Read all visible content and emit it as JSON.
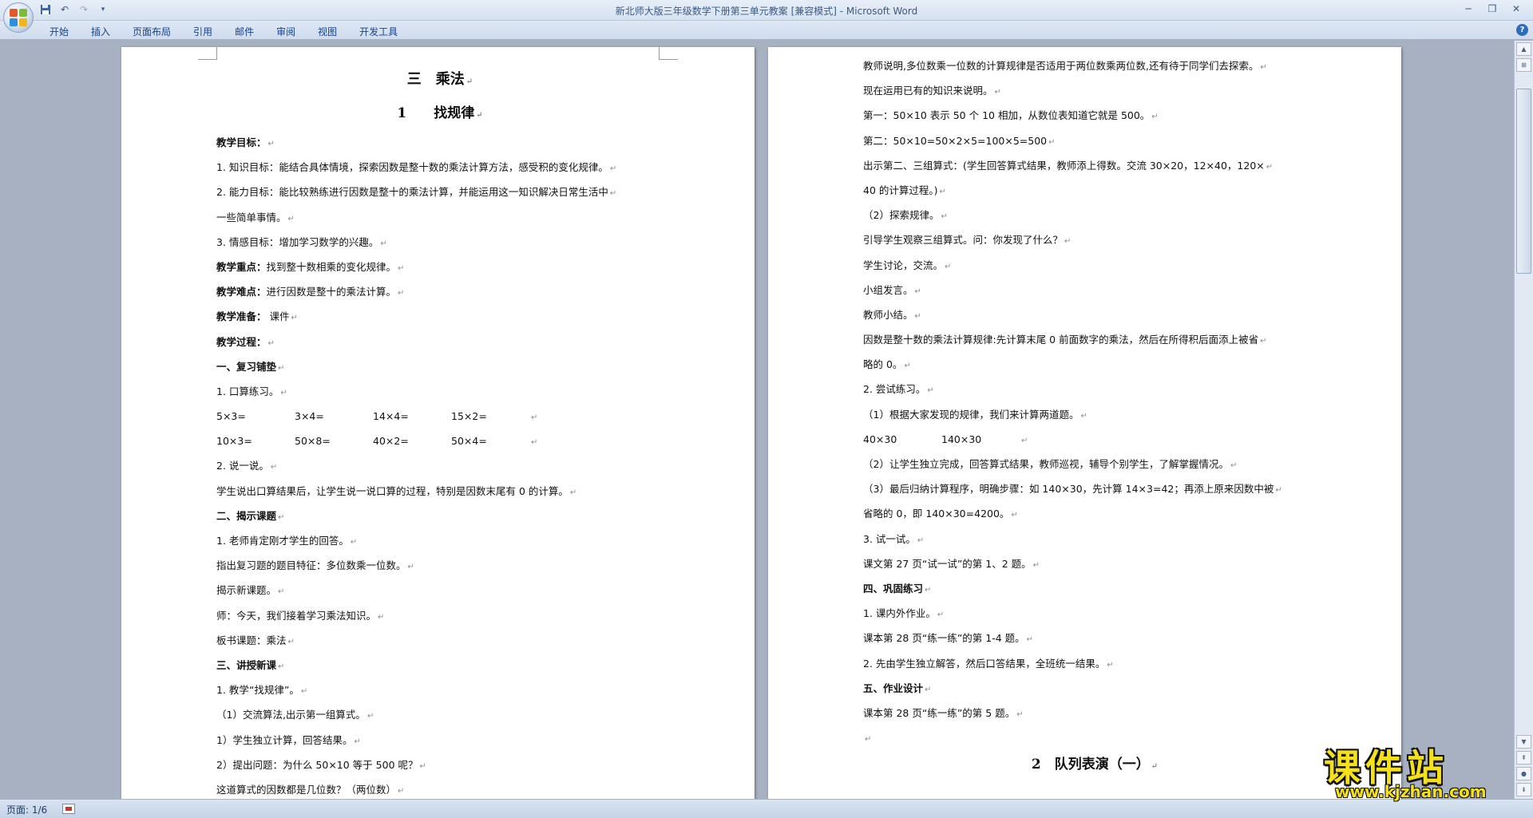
{
  "window": {
    "title": "新北师大版三年级数学下册第三单元教案 [兼容模式] - Microsoft Word"
  },
  "ribbon": {
    "tabs": [
      "开始",
      "插入",
      "页面布局",
      "引用",
      "邮件",
      "审阅",
      "视图",
      "开发工具"
    ]
  },
  "page1": {
    "heading": "三　乘法",
    "subheading": "1　　找规律",
    "lines": [
      {
        "bold": "教学目标：",
        "text": ""
      },
      {
        "bold": "",
        "text": "1. 知识目标：能结合具体情境，探索因数是整十数的乘法计算方法，感受积的变化规律。"
      },
      {
        "bold": "",
        "text": "2. 能力目标：能比较熟练进行因数是整十的乘法计算，并能运用这一知识解决日常生活中"
      },
      {
        "bold": "",
        "text": "一些简单事情。"
      },
      {
        "bold": "",
        "text": "3. 情感目标：增加学习数学的兴趣。"
      },
      {
        "bold": "教学重点：",
        "text": "找到整十数相乘的变化规律。"
      },
      {
        "bold": "教学难点：",
        "text": "进行因数是整十的乘法计算。"
      },
      {
        "bold": "教学准备：",
        "text": " 课件"
      },
      {
        "bold": "教学过程：",
        "text": ""
      },
      {
        "bold": "一、复习铺垫",
        "text": ""
      },
      {
        "bold": "",
        "text": "1. 口算练习。"
      },
      {
        "bold": "",
        "cols": [
          "5×3=",
          "3×4=",
          "14×4=",
          "15×2="
        ]
      },
      {
        "bold": "",
        "cols": [
          "10×3=",
          "50×8=",
          "40×2=",
          "50×4="
        ]
      },
      {
        "bold": "",
        "text": "2. 说一说。"
      },
      {
        "bold": "",
        "text": "学生说出口算结果后，让学生说一说口算的过程，特别是因数末尾有 0 的计算。"
      },
      {
        "bold": "二、揭示课题",
        "text": ""
      },
      {
        "bold": "",
        "text": "1. 老师肯定刚才学生的回答。"
      },
      {
        "bold": "",
        "text": "指出复习题的题目特征：多位数乘一位数。"
      },
      {
        "bold": "",
        "text": "揭示新课题。"
      },
      {
        "bold": "",
        "text": "师：今天，我们接着学习乘法知识。"
      },
      {
        "bold": "",
        "text": "板书课题：乘法"
      },
      {
        "bold": "三、讲授新课",
        "text": ""
      },
      {
        "bold": "",
        "text": "1. 教学“找规律”。"
      },
      {
        "bold": "",
        "text": "（1）交流算法,出示第一组算式。"
      },
      {
        "bold": "",
        "text": "1）学生独立计算，回答结果。"
      },
      {
        "bold": "",
        "text": "2）提出问题：为什么 50×10 等于 500 呢？"
      },
      {
        "bold": "",
        "text": "这道算式的因数都是几位数？（两位数）"
      }
    ]
  },
  "page2": {
    "lines": [
      {
        "bold": "",
        "text": "教师说明,多位数乘一位数的计算规律是否适用于两位数乘两位数,还有待于同学们去探索。"
      },
      {
        "bold": "",
        "text": "现在运用已有的知识来说明。"
      },
      {
        "bold": "",
        "text": "第一：50×10 表示 50 个 10 相加，从数位表知道它就是 500。"
      },
      {
        "bold": "",
        "text": "第二：50×10=50×2×5=100×5=500"
      },
      {
        "bold": "",
        "text": "出示第二、三组算式：(学生回答算式结果，教师添上得数。交流 30×20，12×40，120×"
      },
      {
        "bold": "",
        "text": "40 的计算过程。)"
      },
      {
        "bold": "",
        "text": "（2）探索规律。"
      },
      {
        "bold": "",
        "text": "引导学生观察三组算式。问：你发现了什么？"
      },
      {
        "bold": "",
        "text": "学生讨论，交流。"
      },
      {
        "bold": "",
        "text": "小组发言。"
      },
      {
        "bold": "",
        "text": "教师小结。"
      },
      {
        "bold": "",
        "text": "因数是整十数的乘法计算规律:先计算末尾 0 前面数字的乘法，然后在所得积后面添上被省"
      },
      {
        "bold": "",
        "text": "略的 0。"
      },
      {
        "bold": "",
        "text": "2. 尝试练习。"
      },
      {
        "bold": "",
        "text": "（1）根据大家发现的规律，我们来计算两道题。"
      },
      {
        "bold": "",
        "cols": [
          "40×30",
          "140×30"
        ]
      },
      {
        "bold": "",
        "text": "（2）让学生独立完成，回答算式结果，教师巡视，辅导个别学生，了解掌握情况。"
      },
      {
        "bold": "",
        "text": "（3）最后归纳计算程序，明确步骤：如 140×30，先计算 14×3=42；再添上原来因数中被"
      },
      {
        "bold": "",
        "text": "省略的 0，即 140×30=4200。"
      },
      {
        "bold": "",
        "text": "3. 试一试。"
      },
      {
        "bold": "",
        "text": "课文第 27 页“试一试”的第 1、2 题。"
      },
      {
        "bold": "四、巩固练习",
        "text": ""
      },
      {
        "bold": "",
        "text": "1. 课内外作业。"
      },
      {
        "bold": "",
        "text": "课本第 28 页“练一练”的第 1-4 题。"
      },
      {
        "bold": "",
        "text": "2. 先由学生独立解答，然后口答结果，全班统一结果。"
      },
      {
        "bold": "五、作业设计",
        "text": ""
      },
      {
        "bold": "",
        "text": "课本第 28 页“练一练”的第 5 题。"
      },
      {
        "bold": "",
        "text": ""
      }
    ],
    "next_heading": "2　队列表演（一）"
  },
  "statusbar": {
    "page": "页面: 1/6"
  },
  "watermark": {
    "title": "课件站",
    "url": "www.kjzhan.com"
  },
  "colors": {
    "workspace": "#a7b1c1",
    "ribbon_text": "#15428b",
    "watermark": "#f4e11a"
  }
}
